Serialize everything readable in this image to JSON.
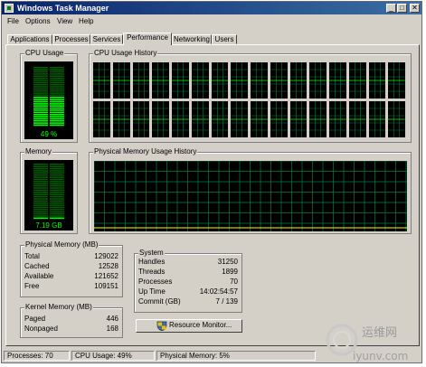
{
  "window": {
    "title": "Windows Task Manager",
    "buttons": [
      "_",
      "□",
      "✕"
    ]
  },
  "menu": [
    "File",
    "Options",
    "View",
    "Help"
  ],
  "tabs": [
    "Applications",
    "Processes",
    "Services",
    "Performance",
    "Networking",
    "Users"
  ],
  "active_tab": "Performance",
  "cpu_usage": {
    "label": "CPU Usage",
    "value": "49 %",
    "percent": 49
  },
  "cpu_history": {
    "label": "CPU Usage History",
    "cores": 32
  },
  "memory": {
    "label": "Memory",
    "value": "7.19 GB"
  },
  "memory_history": {
    "label": "Physical Memory Usage History"
  },
  "physical_memory": {
    "label": "Physical Memory (MB)",
    "rows": [
      {
        "label": "Total",
        "value": "129022"
      },
      {
        "label": "Cached",
        "value": "12528"
      },
      {
        "label": "Available",
        "value": "121652"
      },
      {
        "label": "Free",
        "value": "109151"
      }
    ]
  },
  "kernel_memory": {
    "label": "Kernel Memory (MB)",
    "rows": [
      {
        "label": "Paged",
        "value": "446"
      },
      {
        "label": "Nonpaged",
        "value": "168"
      }
    ]
  },
  "system": {
    "label": "System",
    "rows": [
      {
        "label": "Handles",
        "value": "31250"
      },
      {
        "label": "Threads",
        "value": "1899"
      },
      {
        "label": "Processes",
        "value": "70"
      },
      {
        "label": "Up Time",
        "value": "14:02:54:57"
      },
      {
        "label": "Commit (GB)",
        "value": "7 / 139"
      }
    ]
  },
  "resource_monitor_button": "Resource Monitor...",
  "status": {
    "processes": "Processes: 70",
    "cpu": "CPU Usage: 49%",
    "memory": "Physical Memory: 5%"
  },
  "watermark": {
    "line1": "运维网",
    "line2": "iyunv.com"
  },
  "colors": {
    "graph_green": "#00ff00",
    "grid_green": "#008040",
    "memory_line": "#ffff00",
    "title_bar": "#0a246a"
  }
}
